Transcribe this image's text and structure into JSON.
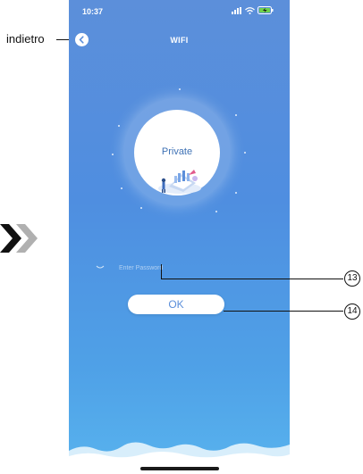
{
  "annotations": {
    "back_label": "indietro",
    "callout_password": "13",
    "callout_ok": "14"
  },
  "status_bar": {
    "time": "10:37"
  },
  "header": {
    "title": "WIFI"
  },
  "network": {
    "name": "Private"
  },
  "password": {
    "placeholder": "Enter Password",
    "value": ""
  },
  "ok_button": {
    "label": "OK"
  },
  "colors": {
    "background_top": "#5c8fda",
    "background_bottom": "#58b3ee",
    "accent_text": "#3f72b5"
  },
  "icons": {
    "back": "chevron-left-icon",
    "eye": "eye-closed-icon",
    "next_step": "double-chevron-right-icon"
  }
}
